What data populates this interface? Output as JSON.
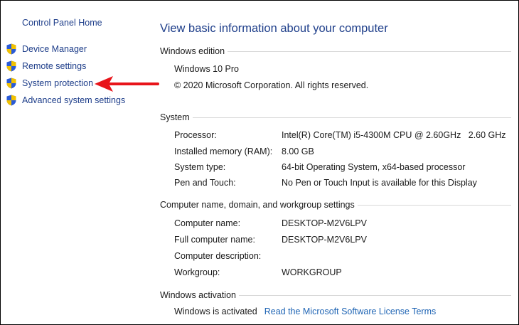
{
  "sidebar": {
    "home_link": "Control Panel Home",
    "tasks": [
      {
        "label": "Device Manager",
        "icon": "uac-shield-icon"
      },
      {
        "label": "Remote settings",
        "icon": "uac-shield-icon"
      },
      {
        "label": "System protection",
        "icon": "uac-shield-icon"
      },
      {
        "label": "Advanced system settings",
        "icon": "uac-shield-icon"
      }
    ],
    "annotation": {
      "icon": "red-arrow-pointing-left",
      "color": "#e8141a"
    }
  },
  "main": {
    "title": "View basic information about your computer",
    "edition": {
      "heading": "Windows edition",
      "name": "Windows 10 Pro",
      "copyright": "© 2020 Microsoft Corporation. All rights reserved."
    },
    "system": {
      "heading": "System",
      "rows": [
        {
          "key": "Processor:",
          "value": "Intel(R) Core(TM) i5-4300M CPU @ 2.60GHz   2.60 GHz"
        },
        {
          "key": "Installed memory (RAM):",
          "value": "8.00 GB"
        },
        {
          "key": "System type:",
          "value": "64-bit Operating System, x64-based processor"
        },
        {
          "key": "Pen and Touch:",
          "value": "No Pen or Touch Input is available for this Display"
        }
      ]
    },
    "network": {
      "heading": "Computer name, domain, and workgroup settings",
      "rows": [
        {
          "key": "Computer name:",
          "value": "DESKTOP-M2V6LPV"
        },
        {
          "key": "Full computer name:",
          "value": "DESKTOP-M2V6LPV"
        },
        {
          "key": "Computer description:",
          "value": ""
        },
        {
          "key": "Workgroup:",
          "value": "WORKGROUP"
        }
      ]
    },
    "activation": {
      "heading": "Windows activation",
      "status": "Windows is activated",
      "license_link": "Read the Microsoft Software License Terms"
    }
  },
  "colors": {
    "link": "#1e3e8a",
    "license_link": "#1e64b4",
    "section_rule": "#d8d8d8",
    "arrow": "#e8141a",
    "shield_blue": "#2a5bd7",
    "shield_yellow": "#f2c200"
  }
}
